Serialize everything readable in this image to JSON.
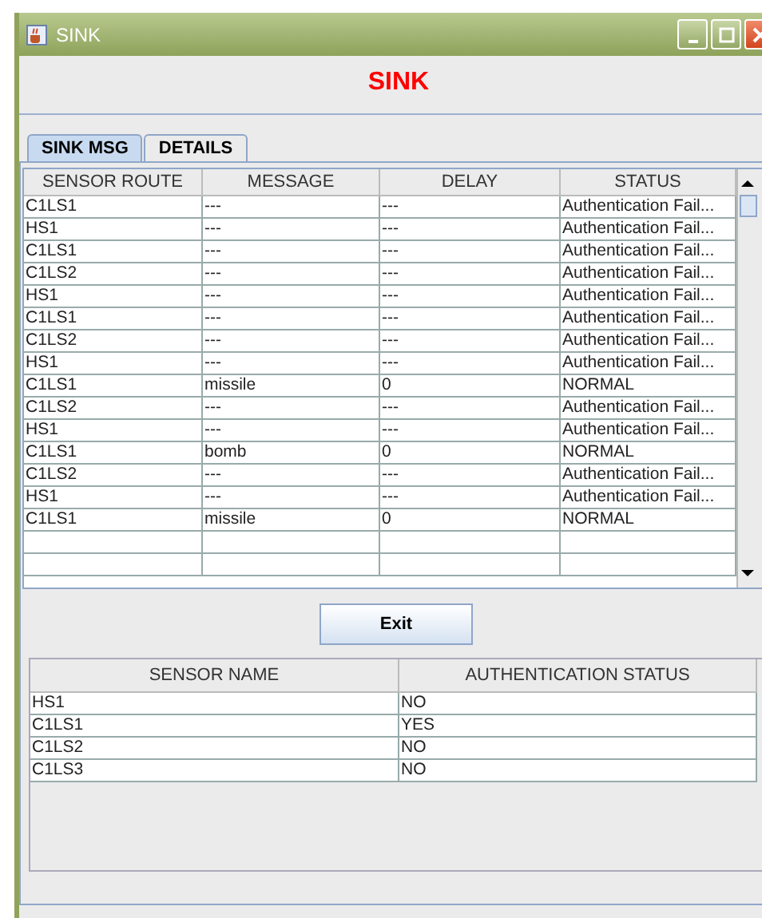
{
  "window": {
    "title": "SINK"
  },
  "heading": "SINK",
  "tabs": [
    {
      "label": "SINK MSG",
      "selected": true
    },
    {
      "label": "DETAILS",
      "selected": false
    }
  ],
  "messages_table": {
    "columns": [
      "SENSOR ROUTE",
      "MESSAGE",
      "DELAY",
      "STATUS"
    ],
    "rows": [
      [
        "C1LS1",
        "---",
        "---",
        "Authentication Fail..."
      ],
      [
        "HS1",
        "---",
        "---",
        "Authentication Fail..."
      ],
      [
        "C1LS1",
        "---",
        "---",
        "Authentication Fail..."
      ],
      [
        "C1LS2",
        "---",
        "---",
        "Authentication Fail..."
      ],
      [
        "HS1",
        "---",
        "---",
        "Authentication Fail..."
      ],
      [
        "C1LS1",
        "---",
        "---",
        "Authentication Fail..."
      ],
      [
        "C1LS2",
        "---",
        "---",
        "Authentication Fail..."
      ],
      [
        "HS1",
        "---",
        "---",
        "Authentication Fail..."
      ],
      [
        "C1LS1",
        "missile",
        "0",
        "NORMAL"
      ],
      [
        "C1LS2",
        "---",
        "---",
        "Authentication Fail..."
      ],
      [
        "HS1",
        "---",
        "---",
        "Authentication Fail..."
      ],
      [
        "C1LS1",
        "bomb",
        "0",
        "NORMAL"
      ],
      [
        "C1LS2",
        "---",
        "---",
        "Authentication Fail..."
      ],
      [
        "HS1",
        "---",
        "---",
        "Authentication Fail..."
      ],
      [
        "C1LS1",
        "missile",
        "0",
        "NORMAL"
      ]
    ]
  },
  "exit_button": "Exit",
  "sensors_table": {
    "columns": [
      "SENSOR NAME",
      "AUTHENTICATION STATUS"
    ],
    "rows": [
      [
        "HS1",
        "NO"
      ],
      [
        "C1LS1",
        "YES"
      ],
      [
        "C1LS2",
        "NO"
      ],
      [
        "C1LS3",
        "NO"
      ]
    ]
  }
}
